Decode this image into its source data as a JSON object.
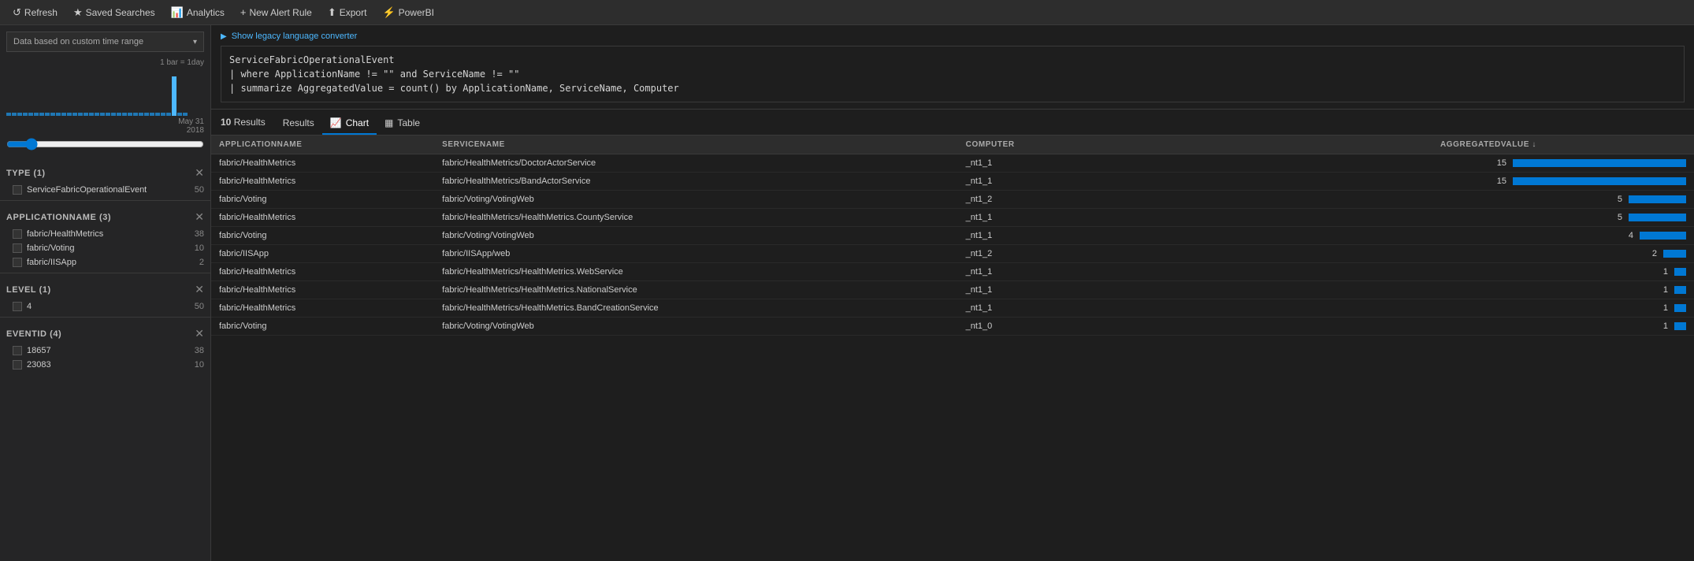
{
  "topnav": {
    "buttons": [
      {
        "id": "refresh",
        "label": "Refresh",
        "icon": "↺"
      },
      {
        "id": "saved-searches",
        "label": "Saved Searches",
        "icon": "★"
      },
      {
        "id": "analytics",
        "label": "Analytics",
        "icon": "📊"
      },
      {
        "id": "new-alert-rule",
        "label": "New Alert Rule",
        "icon": "+"
      },
      {
        "id": "export",
        "label": "Export",
        "icon": "⬆"
      },
      {
        "id": "powerbi",
        "label": "PowerBI",
        "icon": "⚡"
      }
    ]
  },
  "sidebar": {
    "time_range_label": "Data based on custom time range",
    "histogram_label": "1 bar = 1day",
    "histogram_date": "May 31\n2018",
    "filters": [
      {
        "id": "type",
        "header": "TYPE (1)",
        "items": [
          {
            "name": "ServiceFabricOperationalEvent",
            "count": 50
          }
        ]
      },
      {
        "id": "applicationname",
        "header": "APPLICATIONNAME (3)",
        "items": [
          {
            "name": "fabric/HealthMetrics",
            "count": 38
          },
          {
            "name": "fabric/Voting",
            "count": 10
          },
          {
            "name": "fabric/IISApp",
            "count": 2
          }
        ]
      },
      {
        "id": "level",
        "header": "LEVEL (1)",
        "items": [
          {
            "name": "4",
            "count": 50
          }
        ]
      },
      {
        "id": "eventid",
        "header": "EVENTID (4)",
        "items": [
          {
            "name": "18657",
            "count": 38
          },
          {
            "name": "23083",
            "count": 10
          }
        ]
      }
    ]
  },
  "query": {
    "legacy_toggle_label": "Show legacy language converter",
    "lines": [
      "ServiceFabricOperationalEvent",
      "| where ApplicationName != \"\" and ServiceName != \"\"",
      "| summarize AggregatedValue = count() by ApplicationName, ServiceName, Computer"
    ]
  },
  "results": {
    "count_label": "10 Results",
    "count_number": "10",
    "tabs": [
      {
        "id": "results",
        "label": "Results",
        "active": false
      },
      {
        "id": "chart",
        "label": "Chart",
        "icon": "📈",
        "active": true
      },
      {
        "id": "table",
        "label": "Table",
        "icon": "▦",
        "active": false
      }
    ],
    "columns": [
      {
        "id": "applicationname",
        "label": "APPLICATIONNAME"
      },
      {
        "id": "servicename",
        "label": "SERVICENAME"
      },
      {
        "id": "computer",
        "label": "COMPUTER"
      },
      {
        "id": "aggregatedvalue",
        "label": "AGGREGATEDVALUE ↓"
      }
    ],
    "rows": [
      {
        "applicationname": "fabric/HealthMetrics",
        "servicename": "fabric/HealthMetrics/DoctorActorService",
        "computer": "_nt1_1",
        "aggregatedvalue": 15
      },
      {
        "applicationname": "fabric/HealthMetrics",
        "servicename": "fabric/HealthMetrics/BandActorService",
        "computer": "_nt1_1",
        "aggregatedvalue": 15
      },
      {
        "applicationname": "fabric/Voting",
        "servicename": "fabric/Voting/VotingWeb",
        "computer": "_nt1_2",
        "aggregatedvalue": 5
      },
      {
        "applicationname": "fabric/HealthMetrics",
        "servicename": "fabric/HealthMetrics/HealthMetrics.CountyService",
        "computer": "_nt1_1",
        "aggregatedvalue": 5
      },
      {
        "applicationname": "fabric/Voting",
        "servicename": "fabric/Voting/VotingWeb",
        "computer": "_nt1_1",
        "aggregatedvalue": 4
      },
      {
        "applicationname": "fabric/IISApp",
        "servicename": "fabric/IISApp/web",
        "computer": "_nt1_2",
        "aggregatedvalue": 2
      },
      {
        "applicationname": "fabric/HealthMetrics",
        "servicename": "fabric/HealthMetrics/HealthMetrics.WebService",
        "computer": "_nt1_1",
        "aggregatedvalue": 1
      },
      {
        "applicationname": "fabric/HealthMetrics",
        "servicename": "fabric/HealthMetrics/HealthMetrics.NationalService",
        "computer": "_nt1_1",
        "aggregatedvalue": 1
      },
      {
        "applicationname": "fabric/HealthMetrics",
        "servicename": "fabric/HealthMetrics/HealthMetrics.BandCreationService",
        "computer": "_nt1_1",
        "aggregatedvalue": 1
      },
      {
        "applicationname": "fabric/Voting",
        "servicename": "fabric/Voting/VotingWeb",
        "computer": "_nt1_0",
        "aggregatedvalue": 1
      }
    ],
    "max_value": 15
  }
}
